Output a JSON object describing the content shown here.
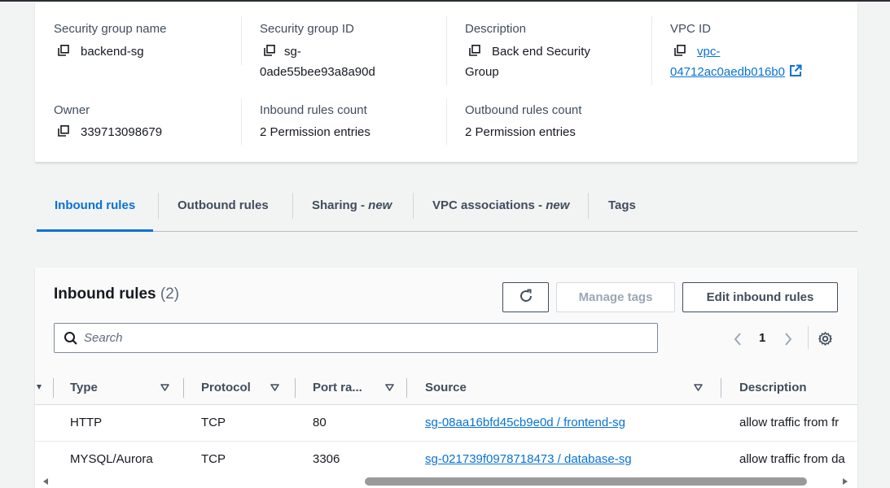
{
  "details": {
    "sg_name_label": "Security group name",
    "sg_name_value": "backend-sg",
    "sg_id_label": "Security group ID",
    "sg_id_line1": "sg-",
    "sg_id_line2": "0ade55bee93a8a90d",
    "description_label": "Description",
    "description_line1": "Back end Security",
    "description_line2": "Group",
    "vpc_label": "VPC ID",
    "vpc_line1": "vpc-",
    "vpc_line2": "04712ac0aedb016b0",
    "owner_label": "Owner",
    "owner_value": "339713098679",
    "inbound_count_label": "Inbound rules count",
    "inbound_count_value": "2 Permission entries",
    "outbound_count_label": "Outbound rules count",
    "outbound_count_value": "2 Permission entries"
  },
  "tabs": [
    {
      "label": "Inbound rules",
      "active": true
    },
    {
      "label": "Outbound rules"
    },
    {
      "label": "Sharing - ",
      "suffix": "new"
    },
    {
      "label": "VPC associations - ",
      "suffix": "new"
    },
    {
      "label": "Tags"
    }
  ],
  "rules_panel": {
    "title": "Inbound rules",
    "count": "(2)",
    "manage_tags": "Manage tags",
    "edit_inbound": "Edit inbound rules",
    "search_placeholder": "Search",
    "page_number": "1",
    "columns": [
      "Type",
      "Protocol",
      "Port ra...",
      "Source",
      "Description"
    ],
    "rows": [
      {
        "type": "HTTP",
        "protocol": "TCP",
        "port": "80",
        "source": "sg-08aa16bfd45cb9e0d / frontend-sg",
        "description": "allow traffic from fr"
      },
      {
        "type": "MYSQL/Aurora",
        "protocol": "TCP",
        "port": "3306",
        "source": "sg-021739f0978718473 / database-sg",
        "description": "allow traffic from da"
      }
    ]
  },
  "colors": {
    "accent": "#0972d3",
    "text": "#16191f",
    "muted": "#414d5c"
  }
}
